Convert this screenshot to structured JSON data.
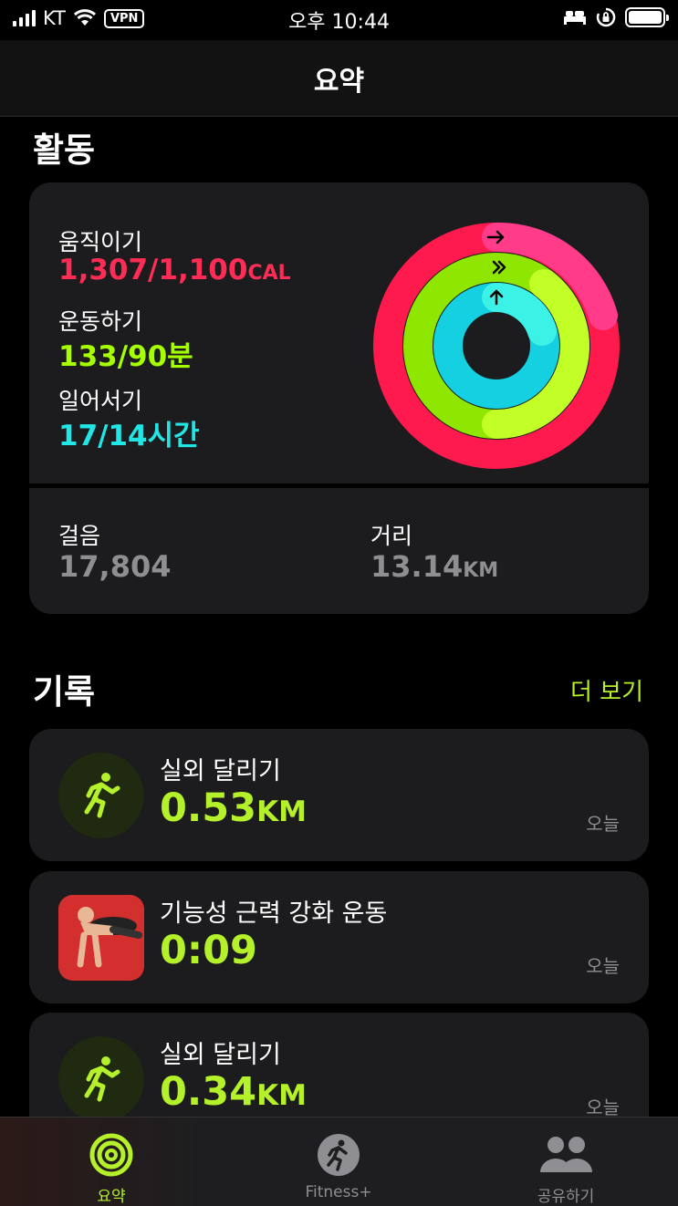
{
  "status_bar": {
    "carrier": "KT",
    "vpn": "VPN",
    "time": "오후 10:44"
  },
  "nav": {
    "title": "요약"
  },
  "activity": {
    "title": "활동",
    "move": {
      "label": "움직이기",
      "value": "1,307/1,100",
      "unit": "CAL",
      "color": "#ff2d55",
      "progress": 1.19
    },
    "exercise": {
      "label": "운동하기",
      "value": "133/90분",
      "color": "#a6ff00",
      "progress": 1.48
    },
    "stand": {
      "label": "일어서기",
      "value": "17/14시간",
      "color": "#22e6e6",
      "progress": 1.21
    },
    "steps": {
      "label": "걸음",
      "value": "17,804"
    },
    "distance": {
      "label": "거리",
      "value": "13.14",
      "unit": "KM"
    }
  },
  "records": {
    "title": "기록",
    "more": "더 보기",
    "items": [
      {
        "title": "실외 달리기",
        "value": "0.53",
        "unit": "KM",
        "date": "오늘",
        "icon": "running-icon"
      },
      {
        "title": "기능성 근력 강화 운동",
        "value": "0:09",
        "unit": "",
        "date": "오늘",
        "icon": "pushup-photo"
      },
      {
        "title": "실외 달리기",
        "value": "0.34",
        "unit": "KM",
        "date": "오늘",
        "icon": "running-icon"
      }
    ]
  },
  "tabs": [
    {
      "label": "요약",
      "icon": "activity-rings-icon",
      "active": true
    },
    {
      "label": "Fitness+",
      "icon": "fitness-plus-icon",
      "active": false
    },
    {
      "label": "공유하기",
      "icon": "sharing-icon",
      "active": false
    }
  ],
  "colors": {
    "accent": "#b4f12a",
    "card": "#1c1c1e"
  }
}
